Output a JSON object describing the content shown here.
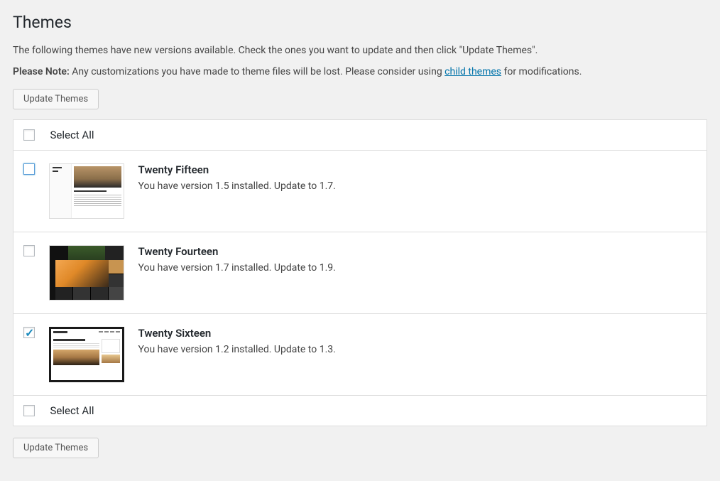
{
  "title": "Themes",
  "intro": "The following themes have new versions available. Check the ones you want to update and then click \"Update Themes\".",
  "note_strong": "Please Note:",
  "note_text_before": " Any customizations you have made to theme files will be lost. Please consider using ",
  "note_link": "child themes",
  "note_text_after": " for modifications.",
  "update_button": "Update Themes",
  "select_all": "Select All",
  "themes": [
    {
      "name": "Twenty Fifteen",
      "desc": "You have version 1.5 installed. Update to 1.7.",
      "checked": false,
      "focused": true
    },
    {
      "name": "Twenty Fourteen",
      "desc": "You have version 1.7 installed. Update to 1.9.",
      "checked": false,
      "focused": false
    },
    {
      "name": "Twenty Sixteen",
      "desc": "You have version 1.2 installed. Update to 1.3.",
      "checked": true,
      "focused": false
    }
  ]
}
